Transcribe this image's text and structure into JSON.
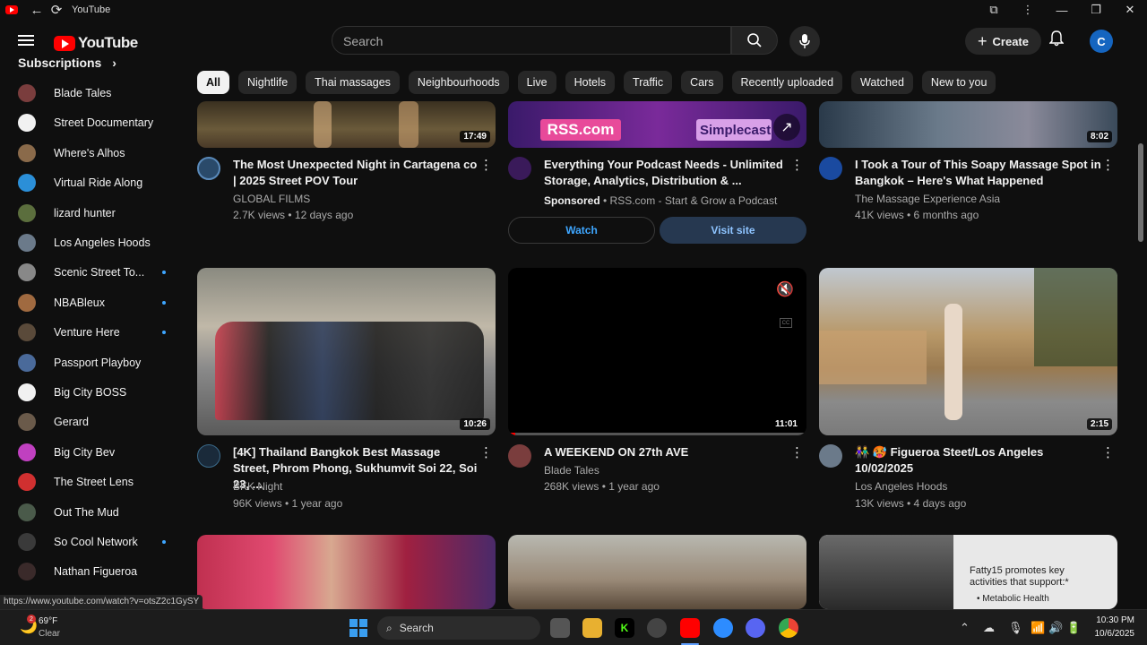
{
  "window": {
    "title": "YouTube"
  },
  "masthead": {
    "logo_text": "YouTube",
    "search_placeholder": "Search",
    "create_label": "Create",
    "avatar_letter": "C"
  },
  "sidebar": {
    "heading": "Subscriptions",
    "items": [
      {
        "label": "Blade Tales",
        "color": "#7a3d3d",
        "dot": false
      },
      {
        "label": "Street Documentary",
        "color": "#f1f1f1",
        "dot": false
      },
      {
        "label": "Where's Alhos",
        "color": "#8a6a4a",
        "dot": false
      },
      {
        "label": "Virtual Ride Along",
        "color": "#2b8fd8",
        "dot": false
      },
      {
        "label": "lizard hunter",
        "color": "#5b6e3d",
        "dot": false
      },
      {
        "label": "Los Angeles Hoods",
        "color": "#6b7a8a",
        "dot": false
      },
      {
        "label": "Scenic Street To...",
        "color": "#888888",
        "dot": true
      },
      {
        "label": "NBABleux",
        "color": "#a06a40",
        "dot": true
      },
      {
        "label": "Venture Here",
        "color": "#5a4a3a",
        "dot": true
      },
      {
        "label": "Passport Playboy",
        "color": "#4a6a9a",
        "dot": false
      },
      {
        "label": "Big City BOSS",
        "color": "#f1f1f1",
        "dot": false
      },
      {
        "label": "Gerard",
        "color": "#6a5a4a",
        "dot": false
      },
      {
        "label": "Big City Bev",
        "color": "#c040c0",
        "dot": false
      },
      {
        "label": "The Street Lens",
        "color": "#d03030",
        "dot": false
      },
      {
        "label": "Out The Mud",
        "color": "#4a5a4a",
        "dot": false
      },
      {
        "label": "So Cool Network",
        "color": "#3a3a3a",
        "dot": true
      },
      {
        "label": "Nathan Figueroa",
        "color": "#3a2a2a",
        "dot": false
      }
    ]
  },
  "chips": [
    "All",
    "Nightlife",
    "Thai massages",
    "Neighbourhoods",
    "Live",
    "Hotels",
    "Traffic",
    "Cars",
    "Recently uploaded",
    "Watched",
    "New to you"
  ],
  "videos_row1": [
    {
      "title": "The Most Unexpected Night in Cartagena co | 2025 Street POV Tour",
      "channel": "GLOBAL FILMS",
      "stats": "2.7K views • 12 days ago",
      "duration": "17:49"
    },
    {
      "title": "I Took a Tour of This Soapy Massage Spot in Bangkok – Here's What Happened",
      "channel": "The Massage Experience Asia",
      "stats": "41K views • 6 months ago",
      "duration": "8:02"
    }
  ],
  "ad": {
    "title": "Everything Your Podcast Needs - Unlimited Storage, Analytics, Distribution & ...",
    "sponsored": "Sponsored",
    "advertiser": "RSS.com - Start & Grow a Podcast",
    "watch": "Watch",
    "visit": "Visit site",
    "thumb_left": "RSS.com",
    "thumb_right": "Simplecast"
  },
  "videos_row2": [
    {
      "title": "[4K] Thailand Bangkok Best Massage Street, Phrom Phong, Sukhumvit Soi 22, Soi 23, ...",
      "channel": "BKK Night",
      "stats": "96K views • 1 year ago",
      "duration": "10:26"
    },
    {
      "title": "A WEEKEND ON 27th AVE",
      "channel": "Blade Tales",
      "stats": "268K views • 1 year ago",
      "duration": "11:01"
    },
    {
      "title": "👫 🥵 Figueroa Steet/Los Angeles 10/02/2025",
      "channel": "Los Angeles Hoods",
      "stats": "13K views • 4 days ago",
      "duration": "2:15"
    }
  ],
  "row3_ad_text": {
    "line1": "Fatty15 promotes key activities that support:*",
    "line2": "• Metabolic Health"
  },
  "status_url": "https://www.youtube.com/watch?v=otsZ2c1GySY",
  "taskbar": {
    "weather_temp": "69°F",
    "weather_cond": "Clear",
    "weather_badge": "2",
    "search": "Search",
    "time": "10:30 PM",
    "date": "10/6/2025"
  }
}
